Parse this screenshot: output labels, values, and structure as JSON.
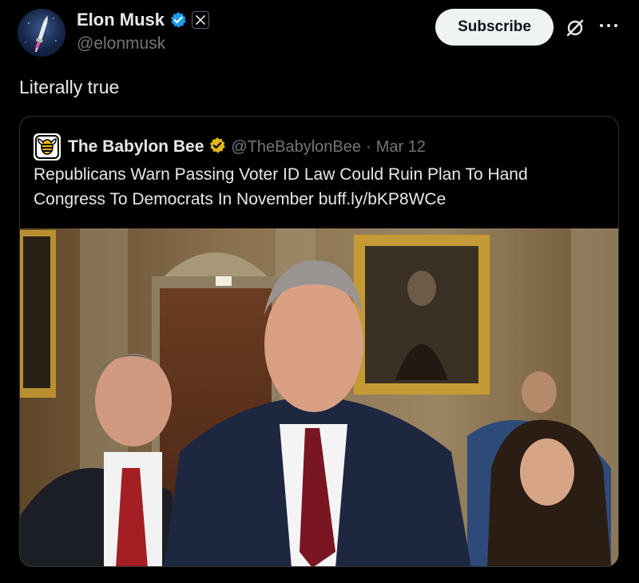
{
  "author": {
    "name": "Elon Musk",
    "handle": "@elonmusk",
    "avatar_icon": "rocket-avatar",
    "verified_icon": "verified-badge-icon",
    "affiliate_icon": "x-logo-icon"
  },
  "actions": {
    "subscribe_label": "Subscribe",
    "grok_icon": "grok-icon",
    "more_icon": "more-icon"
  },
  "tweet": {
    "text": "Literally true"
  },
  "quote": {
    "name": "The Babylon Bee",
    "handle": "@TheBabylonBee",
    "separator": "·",
    "date": "Mar 12",
    "text": "Republicans Warn Passing Voter ID Law Could Ruin Plan To Hand Congress To Democrats In November buff.ly/bKP8WCe",
    "avatar_icon": "babylon-bee-logo",
    "verified_icon": "gold-verified-badge-icon",
    "media_description_icon": "press-conference-photo"
  },
  "colors": {
    "background": "#000000",
    "primary_text": "#e7e9ea",
    "secondary_text": "#71767b",
    "verified_blue": "#1d9bf0",
    "verified_gold": "#e2b719",
    "border": "#2f3336"
  }
}
